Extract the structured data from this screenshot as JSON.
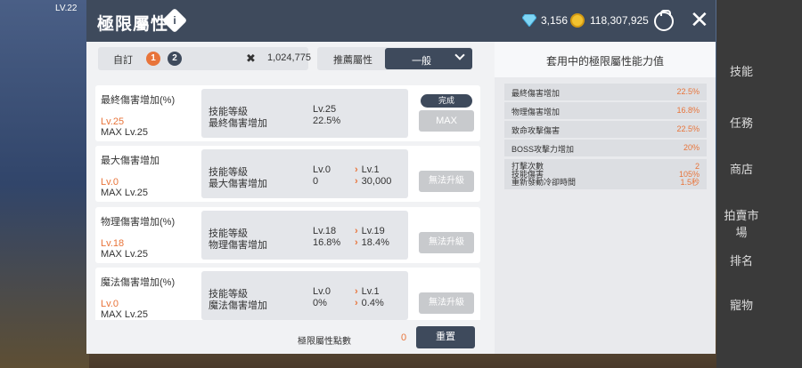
{
  "header": {
    "title": "極限屬性",
    "info_icon": "i",
    "gems": "3,156",
    "coins": "118,307,925",
    "close_label": "✕"
  },
  "controls": {
    "custom_label": "自訂",
    "preset_1": "1",
    "preset_2": "2",
    "points_total": "1,024,775",
    "recommend_label": "推薦屬性",
    "dropdown_value": "一般"
  },
  "skills": [
    {
      "name": "最終傷害增加(%)",
      "level": "Lv.25",
      "max": "MAX Lv.25",
      "k1": "技能等級",
      "k2": "最終傷害增加",
      "c1": "Lv.25",
      "c2": "22.5%",
      "a1": "",
      "a2": "",
      "badge": "完成",
      "button": "MAX"
    },
    {
      "name": "最大傷害增加",
      "level": "Lv.0",
      "max": "MAX Lv.25",
      "k1": "技能等級",
      "k2": "最大傷害增加",
      "c1": "Lv.0",
      "c2": "0",
      "a1": "Lv.1",
      "a2": "30,000",
      "button": "無法升級"
    },
    {
      "name": "物理傷害增加(%)",
      "level": "Lv.18",
      "max": "MAX Lv.25",
      "k1": "技能等級",
      "k2": "物理傷害增加",
      "c1": "Lv.18",
      "c2": "16.8%",
      "a1": "Lv.19",
      "a2": "18.4%",
      "button": "無法升級"
    },
    {
      "name": "魔法傷害增加(%)",
      "level": "Lv.0",
      "max": "MAX Lv.25",
      "k1": "技能等級",
      "k2": "魔法傷害增加",
      "c1": "Lv.0",
      "c2": "0%",
      "a1": "Lv.1",
      "a2": "0.4%",
      "button": "無法升級"
    }
  ],
  "footer": {
    "points_label": "極限屬性點數",
    "points_value": "0",
    "reset_label": "重置"
  },
  "stats_panel": {
    "title": "套用中的極限屬性能力值",
    "items": [
      {
        "label": "最終傷害增加",
        "value": "22.5%"
      },
      {
        "label": "物理傷害增加",
        "value": "16.8%"
      },
      {
        "label": "致命攻擊傷害",
        "value": "22.5%"
      },
      {
        "label": "BOSS攻擊力增加",
        "value": "20%"
      }
    ],
    "multi": [
      {
        "label": "打擊次數",
        "value": "2"
      },
      {
        "label": "技能傷害",
        "value": "105%"
      },
      {
        "label": "重新發動冷卻時間",
        "value": "1.5秒"
      }
    ]
  },
  "game_hud": {
    "level": "LV.22",
    "right_menu": [
      "技能",
      "任務",
      "商店",
      "拍賣市場",
      "排名",
      "寵物"
    ]
  },
  "colors": {
    "accent": "#e8743a",
    "header": "#3e4a5c",
    "panel": "#f1f2f4"
  }
}
